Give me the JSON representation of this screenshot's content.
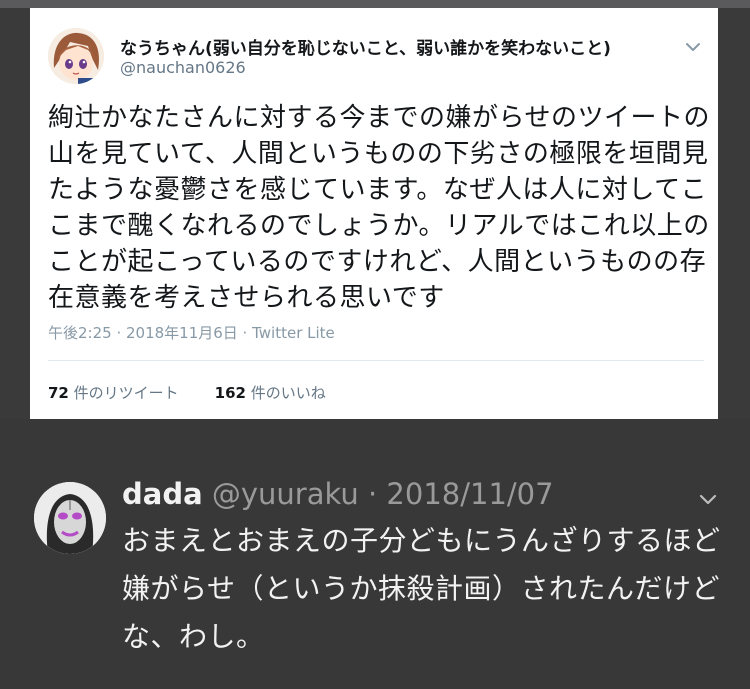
{
  "original_tweet": {
    "display_name": "なうちゃん(弱い自分を恥じないこと、弱い誰かを笑わないこと)",
    "handle": "@nauchan0626",
    "body": "絢辻かなたさんに対する今までの嫌がらせのツイートの山を見ていて、人間というものの下劣さの極限を垣間見たような憂鬱さを感じています。なぜ人は人に対してここまで醜くなれるのでしょうか。リアルではこれ以上のことが起こっているのですけれど、人間というものの存在意義を考えさせられる思いです",
    "timestamp": "午後2:25 · 2018年11月6日 · Twitter Lite",
    "retweet_count": "72",
    "retweet_label": "件のリツイート",
    "like_count": "162",
    "like_label": "件のいいね",
    "caret_icon": "chevron-down-icon"
  },
  "reply_tweet": {
    "display_name": "dada",
    "handle_date": " @yuuraku · 2018/11/07",
    "body": "おまえとおまえの子分どもにうんざりするほど嫌がらせ（というか抹殺計画）されたんだけどな、わし。",
    "caret_icon": "chevron-down-icon"
  },
  "colors": {
    "card_bg": "#ffffff",
    "dark_bg": "#383838",
    "text_dark": "#14171a",
    "text_muted": "#657786",
    "text_light": "#f2f2f2"
  }
}
